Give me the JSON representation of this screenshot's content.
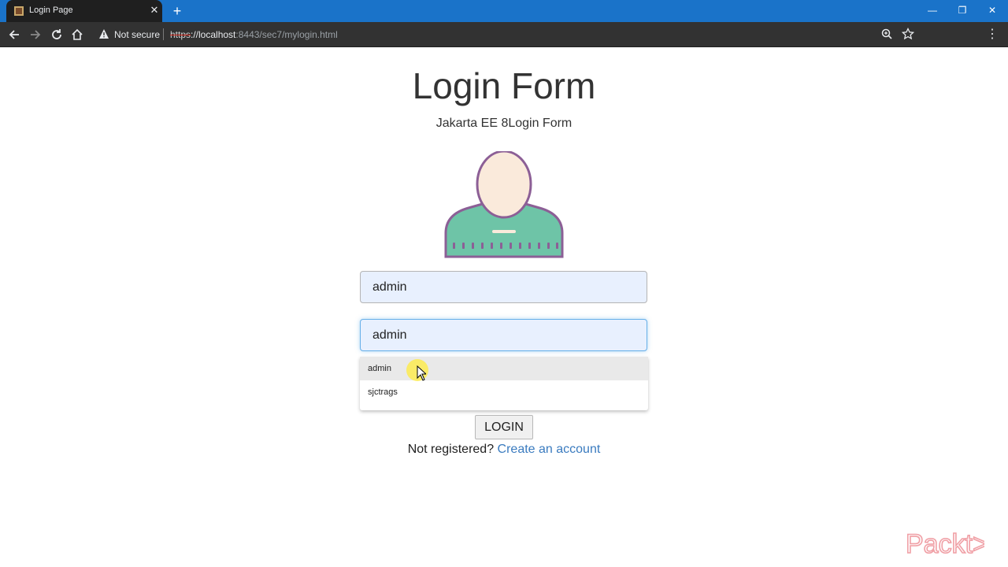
{
  "browser": {
    "tab_title": "Login Page",
    "new_tab_symbol": "+",
    "security_label": "Not secure",
    "url_scheme": "https",
    "url_host": "://localhost",
    "url_rest": ":8443/sec7/mylogin.html",
    "icons": [
      "back-icon",
      "forward-icon",
      "reload-icon",
      "home-icon",
      "warning-icon",
      "zoom-icon",
      "star-icon",
      "menu-icon",
      "minimize-icon",
      "restore-icon",
      "close-icon"
    ]
  },
  "page": {
    "title": "Login Form",
    "subtitle": "Jakarta EE 8Login Form",
    "username_value": "admin",
    "password_value": "admin",
    "autocomplete": [
      {
        "label": "admin",
        "highlighted": true
      },
      {
        "label": "sjctrags",
        "highlighted": false
      }
    ],
    "login_label": "LOGIN",
    "register_prefix": "Not registered?",
    "register_link": "Create an account"
  },
  "branding": {
    "logo_text": "Packt>"
  },
  "colors": {
    "titlebar": "#1a73c9",
    "toolbar": "#323232",
    "input_fill": "#e8f0fe",
    "link": "#3a7bbf",
    "avatar_outline": "#8c5f96",
    "avatar_body": "#6ec4a7",
    "avatar_skin": "#faeadb",
    "logo": "#f0a0a6"
  }
}
